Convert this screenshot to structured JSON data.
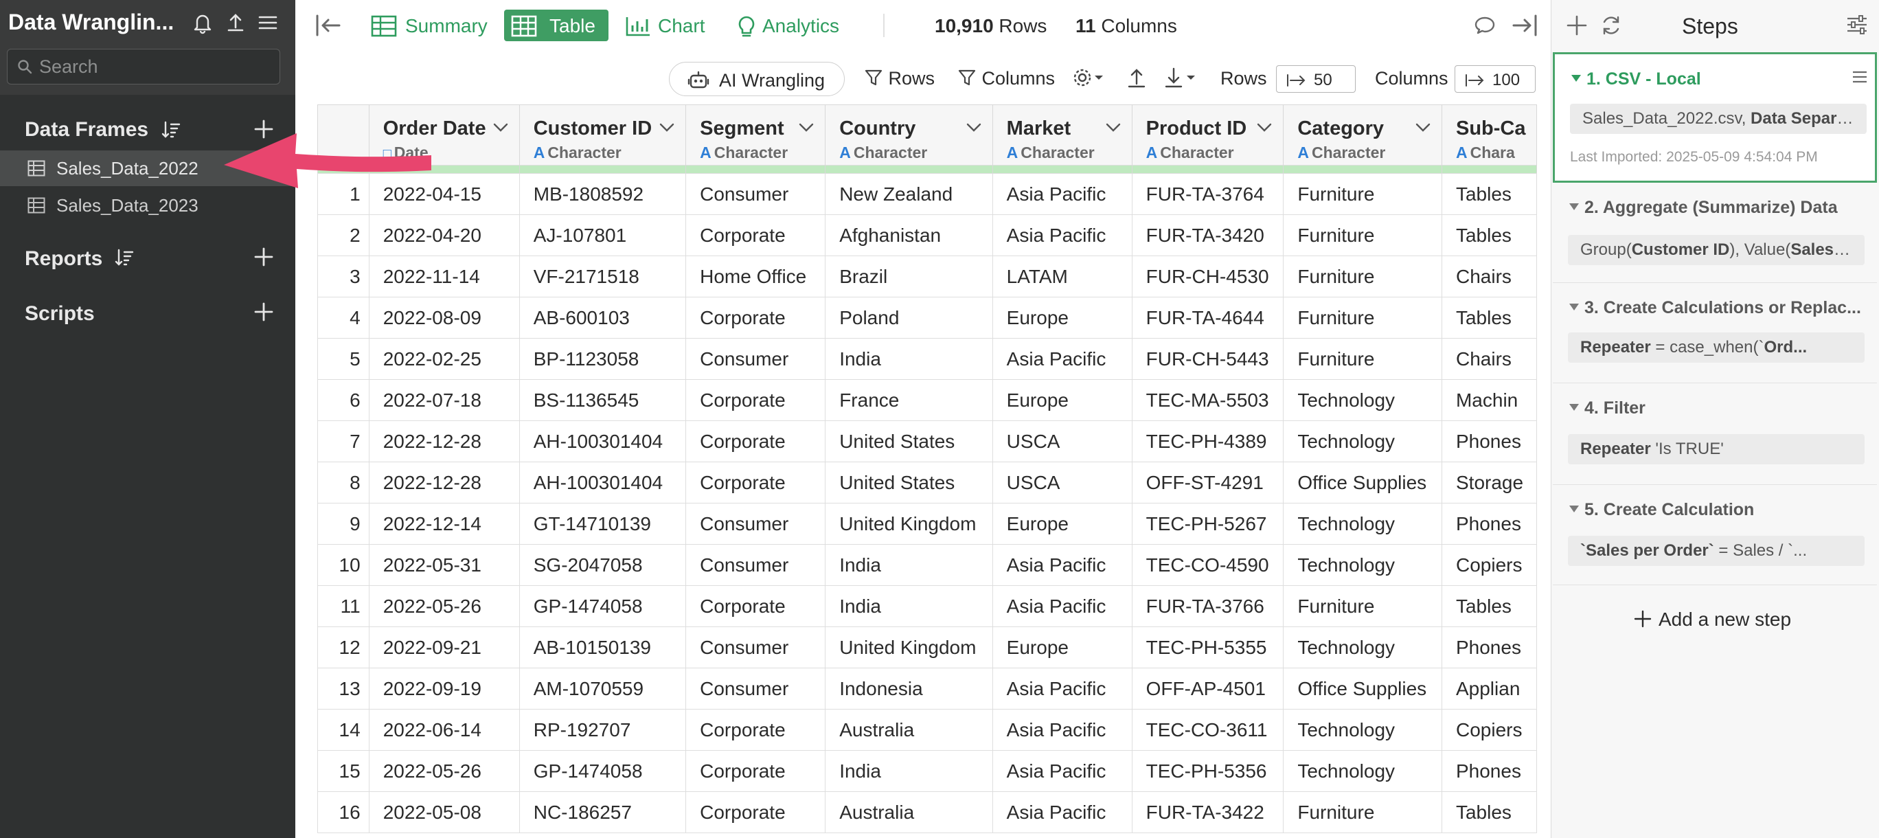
{
  "sidebar": {
    "app_title": "Data Wranglin...",
    "search_placeholder": "Search",
    "data_frames_label": "Data Frames",
    "data_frames": [
      {
        "label": "Sales_Data_2022",
        "active": true
      },
      {
        "label": "Sales_Data_2023",
        "active": false
      }
    ],
    "reports_label": "Reports",
    "scripts_label": "Scripts"
  },
  "toolbar": {
    "summary_label": "Summary",
    "table_label": "Table",
    "chart_label": "Chart",
    "analytics_label": "Analytics",
    "rows_count": "10,910",
    "rows_word": "Rows",
    "columns_count": "11",
    "columns_word": "Columns"
  },
  "subtoolbar": {
    "ai_label": "AI Wrangling",
    "rows_filter_label": "Rows",
    "columns_filter_label": "Columns",
    "rows_label": "Rows",
    "rows_value": "50",
    "columns_label": "Columns",
    "columns_value": "100"
  },
  "table": {
    "columns": [
      {
        "name": "Order Date",
        "type": "Date"
      },
      {
        "name": "Customer ID",
        "type": "Character"
      },
      {
        "name": "Segment",
        "type": "Character"
      },
      {
        "name": "Country",
        "type": "Character"
      },
      {
        "name": "Market",
        "type": "Character"
      },
      {
        "name": "Product ID",
        "type": "Character"
      },
      {
        "name": "Category",
        "type": "Character"
      },
      {
        "name": "Sub-Ca",
        "type": "Chara"
      }
    ],
    "rows": [
      [
        "1",
        "2022-04-15",
        "MB-1808592",
        "Consumer",
        "New Zealand",
        "Asia Pacific",
        "FUR-TA-3764",
        "Furniture",
        "Tables"
      ],
      [
        "2",
        "2022-04-20",
        "AJ-107801",
        "Corporate",
        "Afghanistan",
        "Asia Pacific",
        "FUR-TA-3420",
        "Furniture",
        "Tables"
      ],
      [
        "3",
        "2022-11-14",
        "VF-2171518",
        "Home Office",
        "Brazil",
        "LATAM",
        "FUR-CH-4530",
        "Furniture",
        "Chairs"
      ],
      [
        "4",
        "2022-08-09",
        "AB-600103",
        "Corporate",
        "Poland",
        "Europe",
        "FUR-TA-4644",
        "Furniture",
        "Tables"
      ],
      [
        "5",
        "2022-02-25",
        "BP-1123058",
        "Consumer",
        "India",
        "Asia Pacific",
        "FUR-CH-5443",
        "Furniture",
        "Chairs"
      ],
      [
        "6",
        "2022-07-18",
        "BS-1136545",
        "Corporate",
        "France",
        "Europe",
        "TEC-MA-5503",
        "Technology",
        "Machin"
      ],
      [
        "7",
        "2022-12-28",
        "AH-100301404",
        "Corporate",
        "United States",
        "USCA",
        "TEC-PH-4389",
        "Technology",
        "Phones"
      ],
      [
        "8",
        "2022-12-28",
        "AH-100301404",
        "Corporate",
        "United States",
        "USCA",
        "OFF-ST-4291",
        "Office Supplies",
        "Storage"
      ],
      [
        "9",
        "2022-12-14",
        "GT-14710139",
        "Consumer",
        "United Kingdom",
        "Europe",
        "TEC-PH-5267",
        "Technology",
        "Phones"
      ],
      [
        "10",
        "2022-05-31",
        "SG-2047058",
        "Consumer",
        "India",
        "Asia Pacific",
        "TEC-CO-4590",
        "Technology",
        "Copiers"
      ],
      [
        "11",
        "2022-05-26",
        "GP-1474058",
        "Corporate",
        "India",
        "Asia Pacific",
        "FUR-TA-3766",
        "Furniture",
        "Tables"
      ],
      [
        "12",
        "2022-09-21",
        "AB-10150139",
        "Consumer",
        "United Kingdom",
        "Europe",
        "TEC-PH-5355",
        "Technology",
        "Phones"
      ],
      [
        "13",
        "2022-09-19",
        "AM-1070559",
        "Consumer",
        "Indonesia",
        "Asia Pacific",
        "OFF-AP-4501",
        "Office Supplies",
        "Applian"
      ],
      [
        "14",
        "2022-06-14",
        "RP-192707",
        "Corporate",
        "Australia",
        "Asia Pacific",
        "TEC-CO-3611",
        "Technology",
        "Copiers"
      ],
      [
        "15",
        "2022-05-26",
        "GP-1474058",
        "Corporate",
        "India",
        "Asia Pacific",
        "TEC-PH-5356",
        "Technology",
        "Phones"
      ],
      [
        "16",
        "2022-05-08",
        "NC-186257",
        "Corporate",
        "Australia",
        "Asia Pacific",
        "FUR-TA-3422",
        "Furniture",
        "Tables"
      ]
    ]
  },
  "steps": {
    "title": "Steps",
    "items": [
      {
        "title": "1. CSV - Local",
        "desc_plain": "Sales_Data_2022.csv, ",
        "desc_bold": "Data Separa...",
        "meta": "Last Imported: 2025-05-09 4:54:04 PM"
      },
      {
        "title": "2. Aggregate (Summarize) Data",
        "desc_plain": "Group(",
        "desc_bold": "Customer ID",
        "desc_rest": "), Value(",
        "desc_bold2": "Sales",
        "desc_rest2": " (..."
      },
      {
        "title": "3. Create Calculations or Replac...",
        "desc_bold": "Repeater",
        "desc_rest": " = case_when(`",
        "desc_bold2": "Ord..."
      },
      {
        "title": "4. Filter",
        "desc_bold": "Repeater",
        "desc_rest": " 'Is TRUE'"
      },
      {
        "title": "5. Create Calculation",
        "desc_bold": "`Sales per Order`",
        "desc_rest": " = Sales / `..."
      }
    ],
    "add_label": "Add a new step"
  },
  "colors": {
    "accent_green": "#3f9d63",
    "sidebar_bg": "#2f3131",
    "annotation_arrow": "#e8456e"
  }
}
